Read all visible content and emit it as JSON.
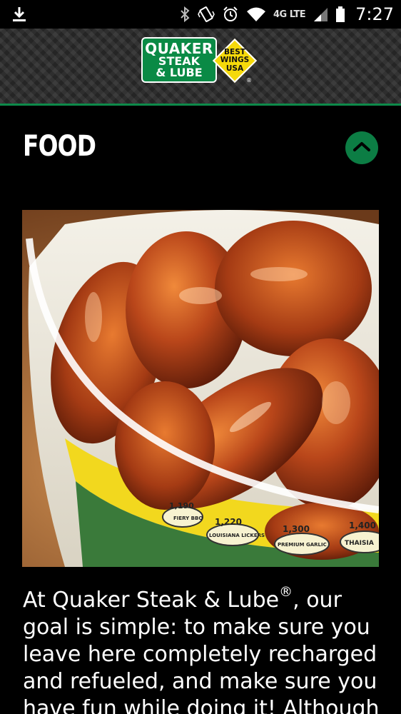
{
  "status_bar": {
    "time": "7:27",
    "network": "4G LTE",
    "icons": [
      "download-icon",
      "bluetooth-icon",
      "vibrate-icon",
      "alarm-icon",
      "wifi-icon",
      "signal-icon",
      "battery-icon"
    ]
  },
  "header": {
    "logo": {
      "line1": "QUAKER",
      "line2": "STEAK",
      "line3": "& LUBE",
      "badge_line1": "BEST",
      "badge_line2": "WINGS",
      "badge_line3": "USA",
      "registered": "®"
    },
    "accent_color": "#0d8a4a"
  },
  "section": {
    "title": "FOOD",
    "collapse_icon": "chevron-up-icon"
  },
  "image": {
    "subject": "bucket of wings",
    "bucket_labels": [
      {
        "number": "1,190",
        "name": "FIERY BBQ"
      },
      {
        "number": "1,220",
        "name": "LOUISIANA LICKERS"
      },
      {
        "number": "1,300",
        "name": "PREMIUM GARLIC"
      },
      {
        "number": "1,400",
        "name": "THAISIA"
      }
    ]
  },
  "content": {
    "para_before": "At Quaker Steak & Lube",
    "para_reg": "®",
    "para_after": ", our goal is simple: to make sure you leave here completely recharged and refueled, and make sure you have fun while doing it! Although"
  }
}
